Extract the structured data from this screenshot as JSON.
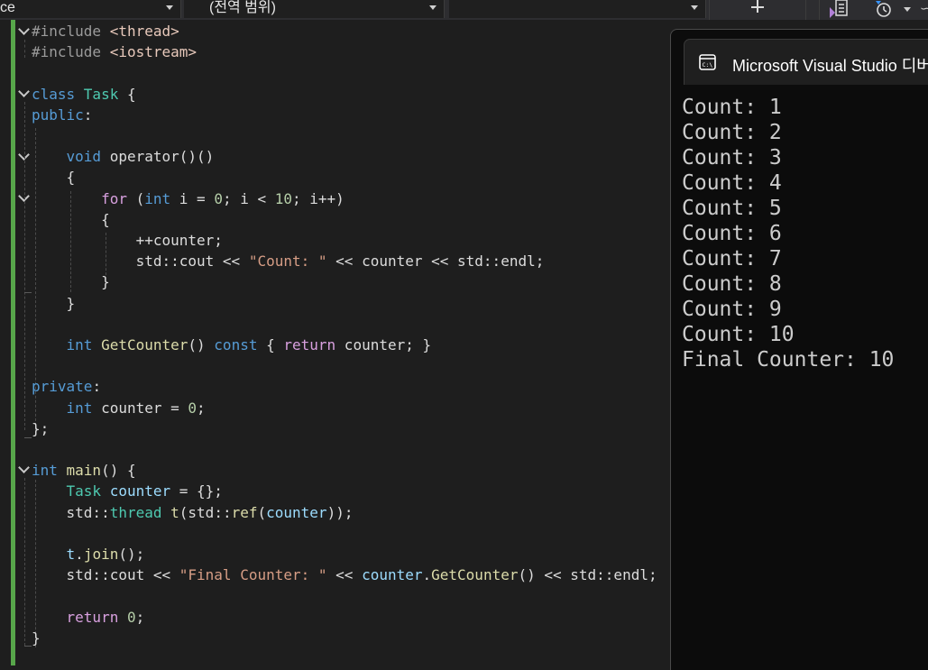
{
  "toolbar": {
    "scope_dropdown": "ce",
    "member_dropdown": "(전역 범위)",
    "third_dropdown": ""
  },
  "editor": {
    "lines": [
      [
        {
          "t": "#include ",
          "c": "pp"
        },
        {
          "t": "<thread>",
          "c": "inc"
        }
      ],
      [
        {
          "t": "#include ",
          "c": "pp"
        },
        {
          "t": "<iostream>",
          "c": "inc"
        }
      ],
      [],
      [
        {
          "t": "class ",
          "c": "kw"
        },
        {
          "t": "Task",
          "c": "ty"
        },
        {
          "t": " {",
          "c": ""
        }
      ],
      [
        {
          "t": "public",
          "c": "kw"
        },
        {
          "t": ":",
          "c": ""
        }
      ],
      [],
      [
        {
          "t": "    ",
          "c": ""
        },
        {
          "t": "void ",
          "c": "kw"
        },
        {
          "t": "operator()()",
          "c": ""
        }
      ],
      [
        {
          "t": "    {",
          "c": ""
        }
      ],
      [
        {
          "t": "        ",
          "c": ""
        },
        {
          "t": "for",
          "c": "ctl"
        },
        {
          "t": " (",
          "c": ""
        },
        {
          "t": "int",
          "c": "kw"
        },
        {
          "t": " i = ",
          "c": ""
        },
        {
          "t": "0",
          "c": "num"
        },
        {
          "t": "; i < ",
          "c": ""
        },
        {
          "t": "10",
          "c": "num"
        },
        {
          "t": "; i++)",
          "c": ""
        }
      ],
      [
        {
          "t": "        {",
          "c": ""
        }
      ],
      [
        {
          "t": "            ++counter;",
          "c": ""
        }
      ],
      [
        {
          "t": "            std::cout << ",
          "c": ""
        },
        {
          "t": "\"Count: \"",
          "c": "str"
        },
        {
          "t": " << counter << std::endl;",
          "c": ""
        }
      ],
      [
        {
          "t": "        }",
          "c": ""
        }
      ],
      [
        {
          "t": "    }",
          "c": ""
        }
      ],
      [],
      [
        {
          "t": "    ",
          "c": ""
        },
        {
          "t": "int ",
          "c": "kw"
        },
        {
          "t": "GetCounter",
          "c": "fn"
        },
        {
          "t": "() ",
          "c": ""
        },
        {
          "t": "const",
          "c": "kw"
        },
        {
          "t": " { ",
          "c": ""
        },
        {
          "t": "return",
          "c": "ctl"
        },
        {
          "t": " counter; }",
          "c": ""
        }
      ],
      [],
      [
        {
          "t": "private",
          "c": "kw"
        },
        {
          "t": ":",
          "c": ""
        }
      ],
      [
        {
          "t": "    ",
          "c": ""
        },
        {
          "t": "int",
          "c": "kw"
        },
        {
          "t": " counter = ",
          "c": ""
        },
        {
          "t": "0",
          "c": "num"
        },
        {
          "t": ";",
          "c": ""
        }
      ],
      [
        {
          "t": "};",
          "c": ""
        }
      ],
      [],
      [
        {
          "t": "int ",
          "c": "kw"
        },
        {
          "t": "main",
          "c": "fn"
        },
        {
          "t": "() {",
          "c": ""
        }
      ],
      [
        {
          "t": "    ",
          "c": ""
        },
        {
          "t": "Task",
          "c": "ty"
        },
        {
          "t": " ",
          "c": ""
        },
        {
          "t": "counter",
          "c": "var"
        },
        {
          "t": " = {};",
          "c": ""
        }
      ],
      [
        {
          "t": "    std::",
          "c": ""
        },
        {
          "t": "thread",
          "c": "ty"
        },
        {
          "t": " ",
          "c": ""
        },
        {
          "t": "t",
          "c": "fn"
        },
        {
          "t": "(std::",
          "c": ""
        },
        {
          "t": "ref",
          "c": "fn"
        },
        {
          "t": "(",
          "c": ""
        },
        {
          "t": "counter",
          "c": "var"
        },
        {
          "t": "));",
          "c": ""
        }
      ],
      [],
      [
        {
          "t": "    ",
          "c": ""
        },
        {
          "t": "t",
          "c": "var"
        },
        {
          "t": ".",
          "c": ""
        },
        {
          "t": "join",
          "c": "fn"
        },
        {
          "t": "();",
          "c": ""
        }
      ],
      [
        {
          "t": "    std::cout << ",
          "c": ""
        },
        {
          "t": "\"Final Counter: \"",
          "c": "str"
        },
        {
          "t": " << ",
          "c": ""
        },
        {
          "t": "counter",
          "c": "var"
        },
        {
          "t": ".",
          "c": ""
        },
        {
          "t": "GetCounter",
          "c": "fn"
        },
        {
          "t": "() << std::endl;",
          "c": ""
        }
      ],
      [],
      [
        {
          "t": "    ",
          "c": ""
        },
        {
          "t": "return",
          "c": "ctl"
        },
        {
          "t": " ",
          "c": ""
        },
        {
          "t": "0",
          "c": "num"
        },
        {
          "t": ";",
          "c": ""
        }
      ],
      [
        {
          "t": "}",
          "c": ""
        }
      ]
    ]
  },
  "console": {
    "title": "Microsoft Visual Studio 디버",
    "output": [
      "Count: 1",
      "Count: 2",
      "Count: 3",
      "Count: 4",
      "Count: 5",
      "Count: 6",
      "Count: 7",
      "Count: 8",
      "Count: 9",
      "Count: 10",
      "Final Counter: 10"
    ]
  },
  "colors": {
    "editor_bg": "#1e1e1e",
    "console_bg": "#0c0c0c",
    "change_bar": "#57a64a",
    "keyword": "#569cd6",
    "control": "#d8a0df",
    "type": "#4ec9b0",
    "function": "#dcdcaa",
    "string": "#d69d85",
    "number": "#b5cea8"
  }
}
